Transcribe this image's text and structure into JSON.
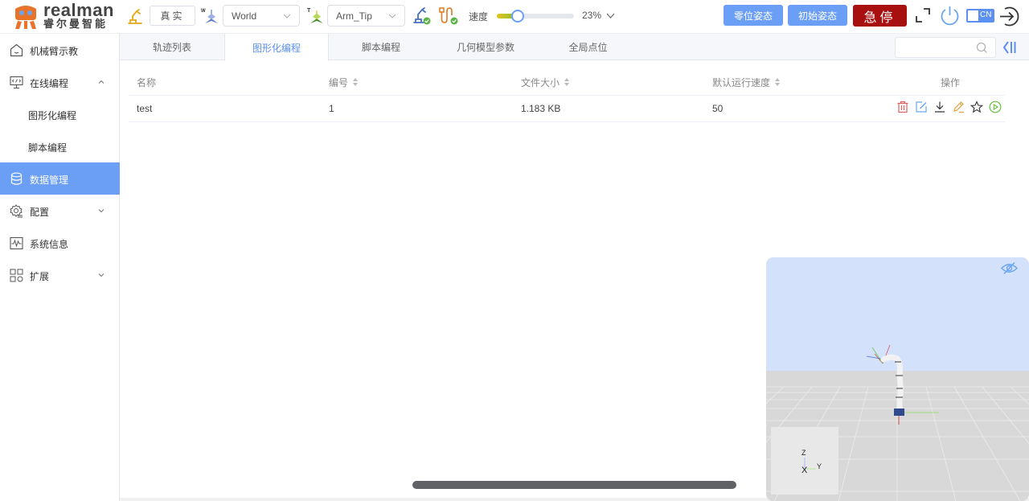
{
  "brand": {
    "name_en": "realman",
    "name_cn": "睿尔曼智能"
  },
  "toolbar": {
    "mode_button": "真实",
    "coord_frame_select": {
      "value": "World",
      "icon": "world-frame-icon"
    },
    "tool_frame_select": {
      "value": "Arm_Tip",
      "icon": "tool-frame-icon"
    },
    "speed_label": "速度",
    "speed_percent": 23,
    "speed_value": "23%",
    "zero_pose_button": "零位姿态",
    "init_pose_button": "初始姿态",
    "estop_button": "急停",
    "lang_toggle": "CN",
    "colors": {
      "accent": "#6b9ef5",
      "estop": "#a80f0f",
      "ok": "#52c41a",
      "warn": "#e6a23c"
    }
  },
  "sidebar": {
    "items": [
      {
        "label": "机械臂示教",
        "icon": "home-icon"
      },
      {
        "label": "在线编程",
        "icon": "code-monitor-icon",
        "expanded": true
      },
      {
        "label": "图形化编程",
        "sub": true
      },
      {
        "label": "脚本编程",
        "sub": true
      },
      {
        "label": "数据管理",
        "icon": "database-icon",
        "active": true
      },
      {
        "label": "配置",
        "icon": "settings-icon",
        "expanded": false
      },
      {
        "label": "系统信息",
        "icon": "pulse-monitor-icon"
      },
      {
        "label": "扩展",
        "icon": "apps-icon",
        "expanded": false
      }
    ]
  },
  "tabs": [
    {
      "label": "轨迹列表"
    },
    {
      "label": "图形化编程",
      "active": true
    },
    {
      "label": "脚本编程"
    },
    {
      "label": "几何模型参数"
    },
    {
      "label": "全局点位"
    }
  ],
  "search": {
    "placeholder": "",
    "value": ""
  },
  "table": {
    "columns": [
      {
        "label": "名称",
        "sortable": false
      },
      {
        "label": "编号",
        "sortable": true
      },
      {
        "label": "文件大小",
        "sortable": true
      },
      {
        "label": "默认运行速度",
        "sortable": true
      },
      {
        "label": "操作",
        "sortable": false
      }
    ],
    "rows": [
      {
        "name": "test",
        "id": "1",
        "size": "1.183 KB",
        "speed": "50",
        "actions": [
          "delete-icon",
          "edit-icon",
          "download-icon",
          "rename-icon",
          "favorite-icon",
          "run-icon"
        ]
      }
    ]
  },
  "viewer": {
    "axis_labels": {
      "z": "Z",
      "x": "X",
      "y": "Y"
    },
    "visibility_toggle": "eye-off-icon"
  }
}
